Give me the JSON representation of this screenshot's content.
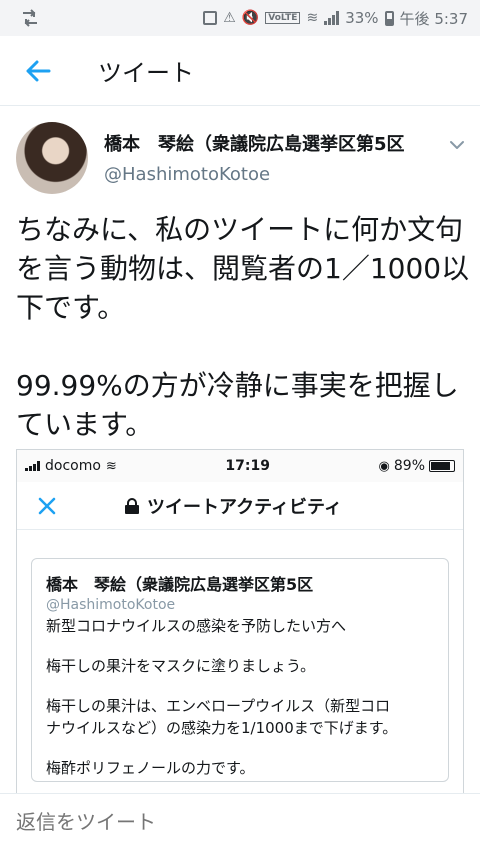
{
  "status_bar": {
    "left_icon": "retweet-notification-icon",
    "battery": "33%",
    "time": "午後 5:37",
    "volte": "VoLTE"
  },
  "header": {
    "back_icon": "back-arrow-icon",
    "title": "ツイート"
  },
  "tweet": {
    "author_name": "橋本　琴絵（衆議院広島選挙区第5区",
    "author_handle": "@HashimotoKotoe",
    "text_lines": [
      "ちなみに、私のツイートに何か文句",
      "を言う動物は、閲覧者の1／1000以",
      "下です。",
      "99.99%の方が冷静に事実を把握し",
      "ています。"
    ]
  },
  "embedded_screenshot": {
    "status": {
      "carrier": "docomo",
      "time": "17:19",
      "battery": "89%"
    },
    "header_title": "ツイートアクティビティ",
    "card": {
      "name": "橋本　琴絵（衆議院広島選挙区第5区",
      "handle": "@HashimotoKotoe",
      "lines": [
        "新型コロナウイルスの感染を予防したい方へ",
        "梅干しの果汁をマスクに塗りましょう。",
        "梅干しの果汁は、エンベロープウイルス（新型コロ",
        "ナウイルスなど）の感染力を1/1000まで下げます。",
        "梅酢ポリフェノールの力です。"
      ]
    }
  },
  "reply": {
    "placeholder": "返信をツイート"
  },
  "colors": {
    "accent": "#1da1f2",
    "secondary_text": "#657786"
  }
}
